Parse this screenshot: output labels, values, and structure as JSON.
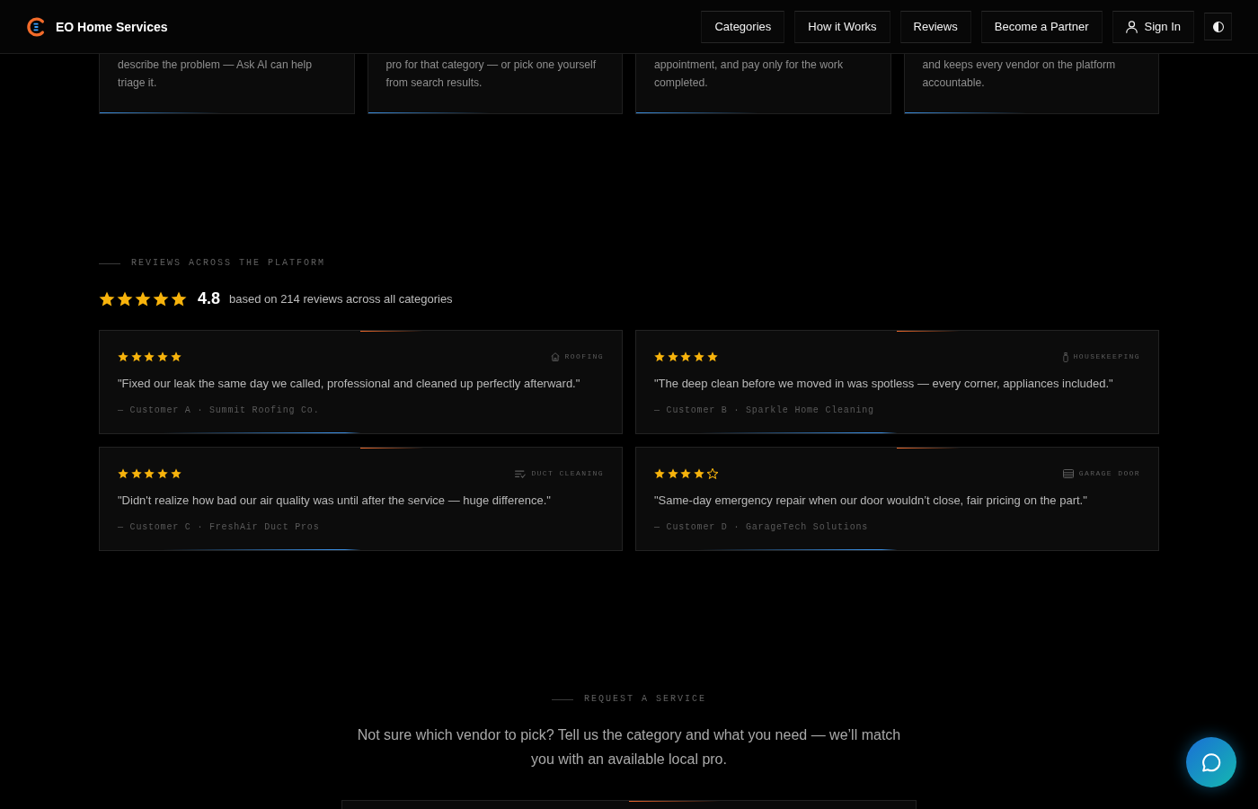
{
  "header": {
    "brand": "EO Home Services",
    "nav": [
      {
        "label": "Categories",
        "kind": "link"
      },
      {
        "label": "How it Works",
        "kind": "link"
      },
      {
        "label": "Reviews",
        "kind": "link"
      },
      {
        "label": "Become a Partner",
        "kind": "link"
      },
      {
        "label": "Sign In",
        "kind": "account"
      }
    ]
  },
  "info_cards": [
    {
      "text": "describe the problem — Ask AI can help triage it."
    },
    {
      "text": "pro for that category — or pick one yourself from search results."
    },
    {
      "text": "appointment, and pay only for the work completed."
    },
    {
      "text": "and keeps every vendor on the platform accountable."
    }
  ],
  "reviews": {
    "eyebrow": "REVIEWS ACROSS THE PLATFORM",
    "summary": {
      "stars": 5,
      "score": "4.8",
      "caption": "based on 214 reviews across all categories"
    },
    "items": [
      {
        "kind": "roofing",
        "stars": 5,
        "category": "ROOFING",
        "quote": "\"Fixed our leak the same day we called, professional and cleaned up perfectly afterward.\"",
        "author": "— Customer A · Summit Roofing Co."
      },
      {
        "kind": "housekeeping",
        "stars": 5,
        "category": "HOUSEKEEPING",
        "quote": "\"The deep clean before we moved in was spotless — every corner, appliances included.\"",
        "author": "— Customer B · Sparkle Home Cleaning"
      },
      {
        "kind": "ducts",
        "stars": 5,
        "category": "DUCT CLEANING",
        "quote": "\"Didn't realize how bad our air quality was until after the service — huge difference.\"",
        "author": "— Customer C · FreshAir Duct Pros"
      },
      {
        "kind": "garage",
        "stars": 4,
        "category": "GARAGE DOOR",
        "quote": "\"Same-day emergency repair when our door wouldn’t close, fair pricing on the part.\"",
        "author": "— Customer D · GarageTech Solutions"
      }
    ]
  },
  "request": {
    "eyebrow": "REQUEST A SERVICE",
    "text": "Not sure which vendor to pick? Tell us the category and what you need — we’ll match you with an available local pro."
  }
}
